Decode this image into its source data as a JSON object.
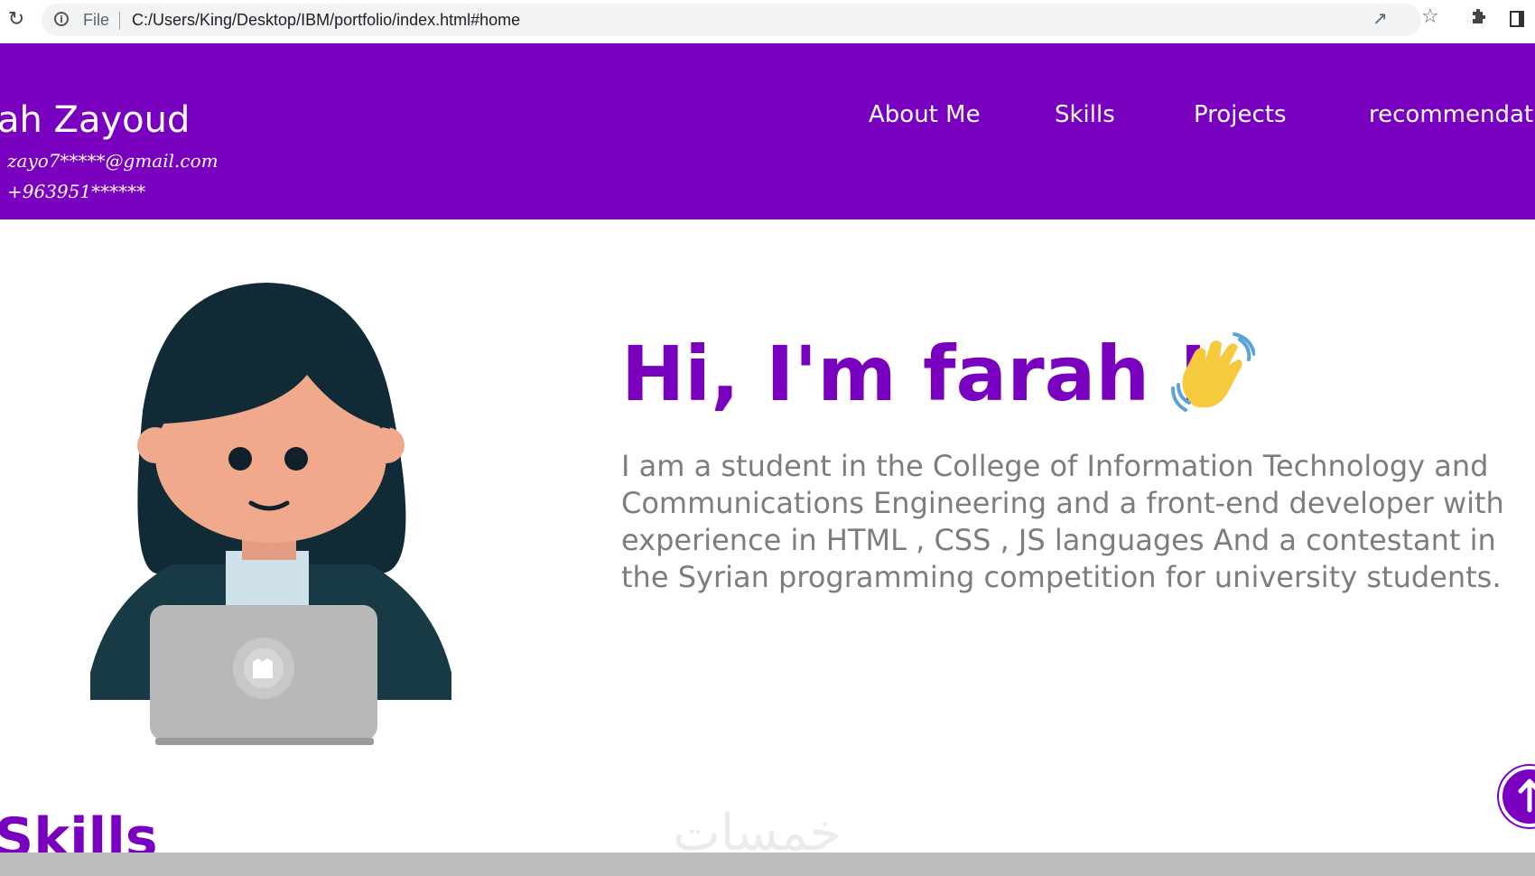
{
  "browser": {
    "url_scheme_label": "File",
    "url": "C:/Users/King/Desktop/IBM/portfolio/index.html#home",
    "icons": [
      "reload-icon",
      "info-icon",
      "share-icon",
      "star-icon",
      "extensions-icon",
      "side-panel-icon"
    ]
  },
  "header": {
    "name": "arah Zayoud",
    "email": "zayo7*****@gmail.com",
    "phone": "+963951******",
    "nav": [
      {
        "label": "About Me"
      },
      {
        "label": "Skills"
      },
      {
        "label": "Projects"
      },
      {
        "label": "recommendati"
      }
    ]
  },
  "hero": {
    "title": "Hi, I'm farah !",
    "wave_icon": "waving-hand-icon",
    "bio": "I am a student in the College of Information Technology and Communications Engineering and a front-end developer with experience in HTML , CSS , JS languages And a contestant in the Syrian programming competition for university students."
  },
  "sections": {
    "skills_heading": "Skills"
  },
  "watermark": "خمسات",
  "colors": {
    "brand_purple": "#7a00bf",
    "bio_gray": "#7d7d7d",
    "header_text": "#ffffff"
  }
}
